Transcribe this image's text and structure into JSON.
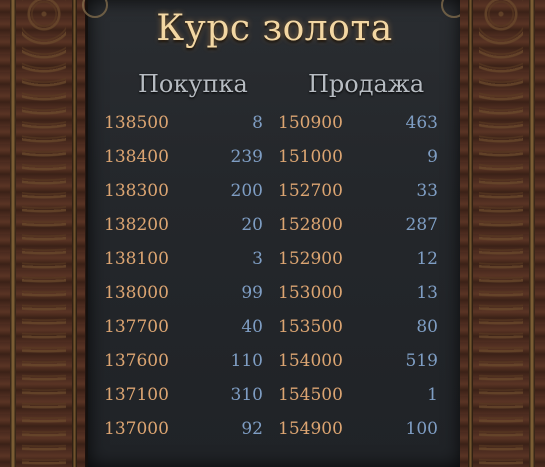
{
  "title": "Курс золота",
  "columns": {
    "buy": "Покупка",
    "sell": "Продажа"
  },
  "rows": [
    {
      "buy_price": "138500",
      "buy_qty": "8",
      "sell_price": "150900",
      "sell_qty": "463"
    },
    {
      "buy_price": "138400",
      "buy_qty": "239",
      "sell_price": "151000",
      "sell_qty": "9"
    },
    {
      "buy_price": "138300",
      "buy_qty": "200",
      "sell_price": "152700",
      "sell_qty": "33"
    },
    {
      "buy_price": "138200",
      "buy_qty": "20",
      "sell_price": "152800",
      "sell_qty": "287"
    },
    {
      "buy_price": "138100",
      "buy_qty": "3",
      "sell_price": "152900",
      "sell_qty": "12"
    },
    {
      "buy_price": "138000",
      "buy_qty": "99",
      "sell_price": "153000",
      "sell_qty": "13"
    },
    {
      "buy_price": "137700",
      "buy_qty": "40",
      "sell_price": "153500",
      "sell_qty": "80"
    },
    {
      "buy_price": "137600",
      "buy_qty": "110",
      "sell_price": "154000",
      "sell_qty": "519"
    },
    {
      "buy_price": "137100",
      "buy_qty": "310",
      "sell_price": "154500",
      "sell_qty": "1"
    },
    {
      "buy_price": "137000",
      "buy_qty": "92",
      "sell_price": "154900",
      "sell_qty": "100"
    }
  ],
  "colors": {
    "title": "#f3d7a3",
    "header": "#b7bcc2",
    "price": "#dca572",
    "quantity": "#7f9ec4",
    "panel": "#24272b",
    "frame": "#4a2a1e"
  }
}
